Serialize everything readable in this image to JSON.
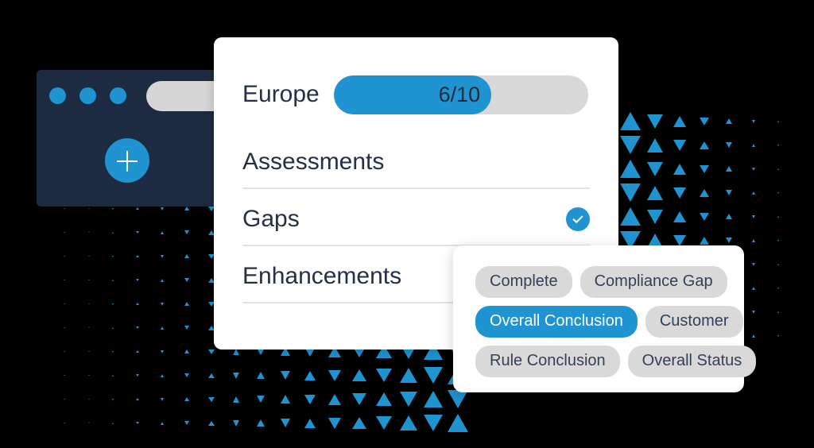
{
  "background": {
    "canvas_color": "#000000",
    "triangle_color": "#2093d1"
  },
  "dark_window": {
    "name": "browser-mock-window",
    "background_color": "#1d2b42",
    "dots": [
      "dot-1",
      "dot-2",
      "dot-3"
    ],
    "search_placeholder": "",
    "search_value": "",
    "add_button_label": "+"
  },
  "main_card": {
    "progress": {
      "region_label": "Europe",
      "value_label": "6/10",
      "value": 6,
      "max": 10,
      "percent": 62,
      "fill_color": "#2093d1",
      "track_color": "#d8d8d8"
    },
    "rows": [
      {
        "label": "Assessments",
        "checked": false
      },
      {
        "label": "Gaps",
        "checked": true
      },
      {
        "label": "Enhancements",
        "checked": false
      }
    ]
  },
  "chips_panel": {
    "rows": [
      [
        {
          "label": "Complete",
          "selected": false
        },
        {
          "label": "Compliance Gap",
          "selected": false
        }
      ],
      [
        {
          "label": "Overall Conclusion",
          "selected": true
        },
        {
          "label": "Customer",
          "selected": false
        }
      ],
      [
        {
          "label": "Rule Conclusion",
          "selected": false
        },
        {
          "label": "Overall Status",
          "selected": false
        }
      ]
    ],
    "selected_color": "#2093d1",
    "chip_color": "#d9d9d9"
  }
}
